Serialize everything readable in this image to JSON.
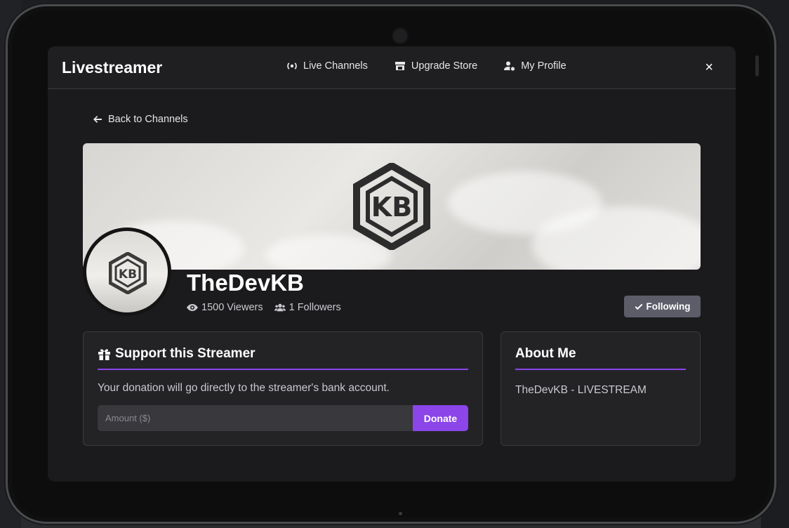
{
  "app": {
    "brand": "Livestreamer",
    "close_label": "×"
  },
  "nav": {
    "items": [
      {
        "label": "Live Channels",
        "icon": "broadcast-icon"
      },
      {
        "label": "Upgrade Store",
        "icon": "store-icon"
      },
      {
        "label": "My Profile",
        "icon": "user-gear-icon"
      }
    ]
  },
  "back_link": {
    "label": "Back to Channels",
    "icon": "arrow-left-icon"
  },
  "channel": {
    "name": "TheDevKB",
    "viewers": "1500 Viewers",
    "followers": "1 Followers",
    "follow_button": "Following",
    "logo_letters": "KB"
  },
  "support": {
    "title": "Support this Streamer",
    "description": "Your donation will go directly to the streamer's bank account.",
    "amount_placeholder": "Amount ($)",
    "donate_label": "Donate"
  },
  "about": {
    "title": "About Me",
    "text": "TheDevKB - LIVESTREAM"
  },
  "colors": {
    "accent": "#8b45e8",
    "follow_button": "#5d5d69",
    "panel": "#232326",
    "background": "#1b1b1d"
  }
}
